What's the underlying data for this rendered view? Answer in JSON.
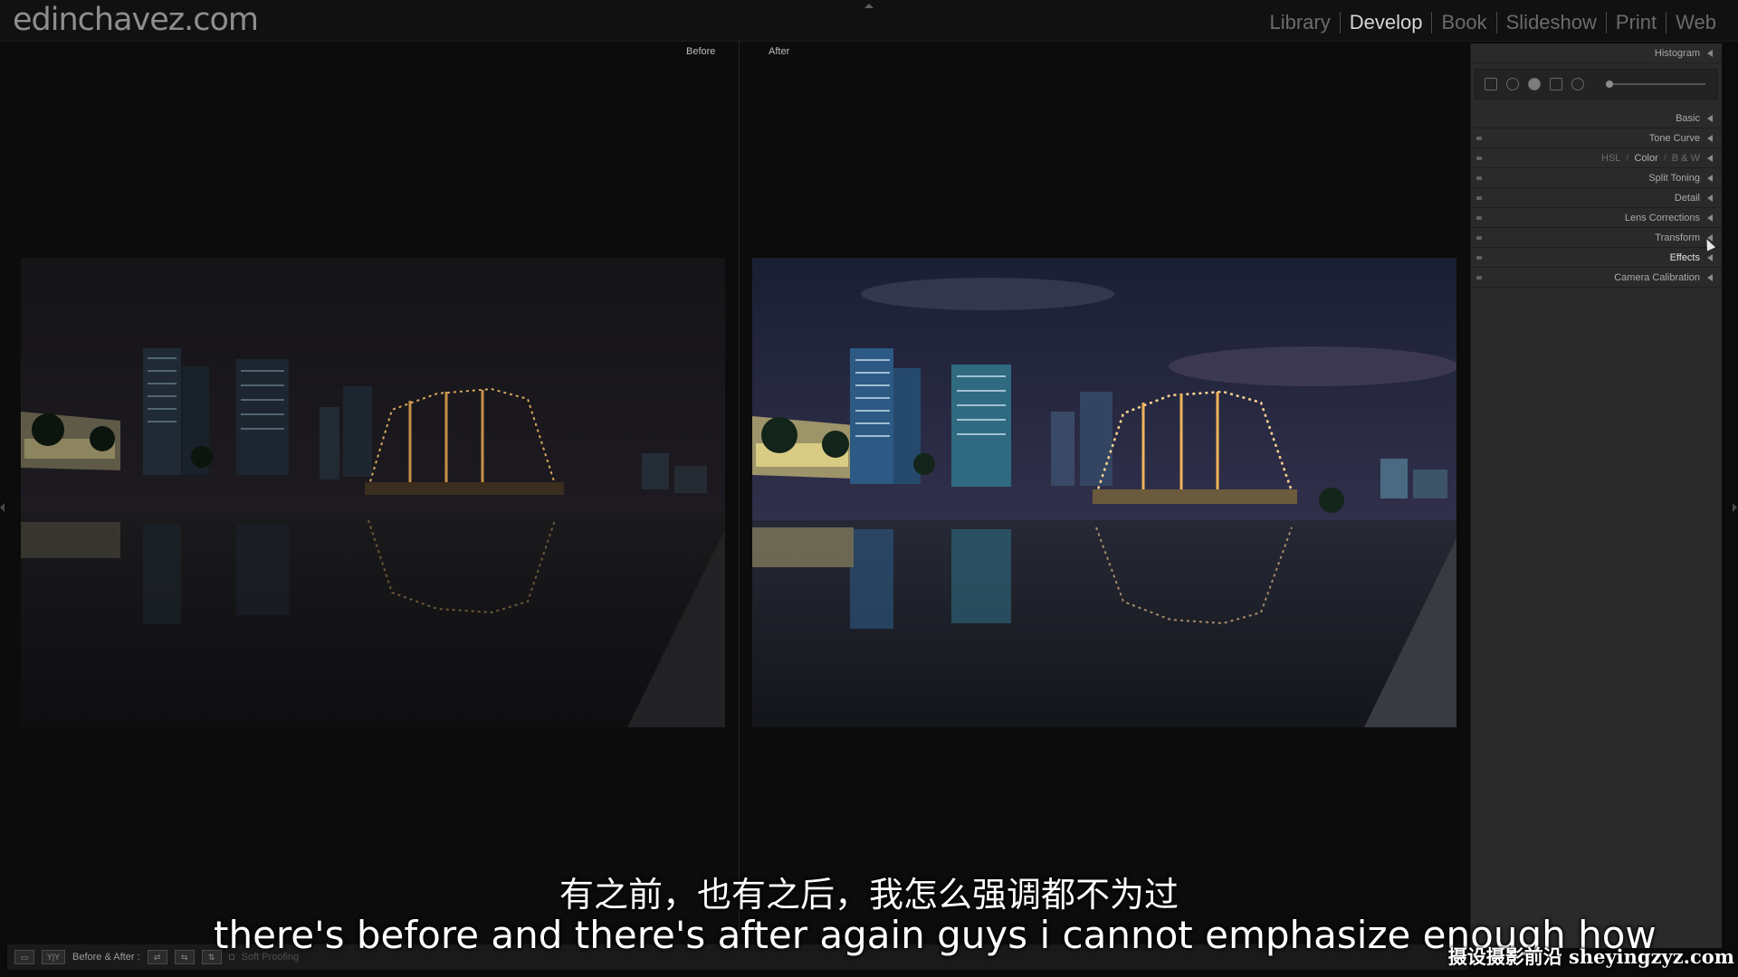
{
  "site": {
    "logo_text": "edinchavez.com"
  },
  "modules": {
    "items": [
      {
        "label": "Library",
        "active": false
      },
      {
        "label": "Develop",
        "active": true
      },
      {
        "label": "Book",
        "active": false
      },
      {
        "label": "Slideshow",
        "active": false
      },
      {
        "label": "Print",
        "active": false
      },
      {
        "label": "Web",
        "active": false
      }
    ]
  },
  "view": {
    "before_label": "Before",
    "after_label": "After"
  },
  "right_panel": {
    "histogram": "Histogram",
    "basic": "Basic",
    "tone_curve": "Tone Curve",
    "hsl": {
      "hsl": "HSL",
      "color": "Color",
      "bw": "B & W",
      "separator": "/"
    },
    "split_toning": "Split Toning",
    "detail": "Detail",
    "lens_corrections": "Lens Corrections",
    "transform": "Transform",
    "effects": "Effects",
    "camera_calibration": "Camera Calibration"
  },
  "toolbar": {
    "before_after": "Before & After :",
    "soft_proofing": "Soft Proofing"
  },
  "subtitles": {
    "chinese": "有之前，也有之后，我怎么强调都不为过",
    "english": "there's before and there's after again guys i cannot emphasize enough how"
  },
  "watermark": "摄设摄影前沿 sheyingzyz.com",
  "colors": {
    "background": "#0b0b0c",
    "panel": "#2a2a2b",
    "active_module": "#d6d6d6",
    "inactive_module": "#6b6b6b"
  }
}
